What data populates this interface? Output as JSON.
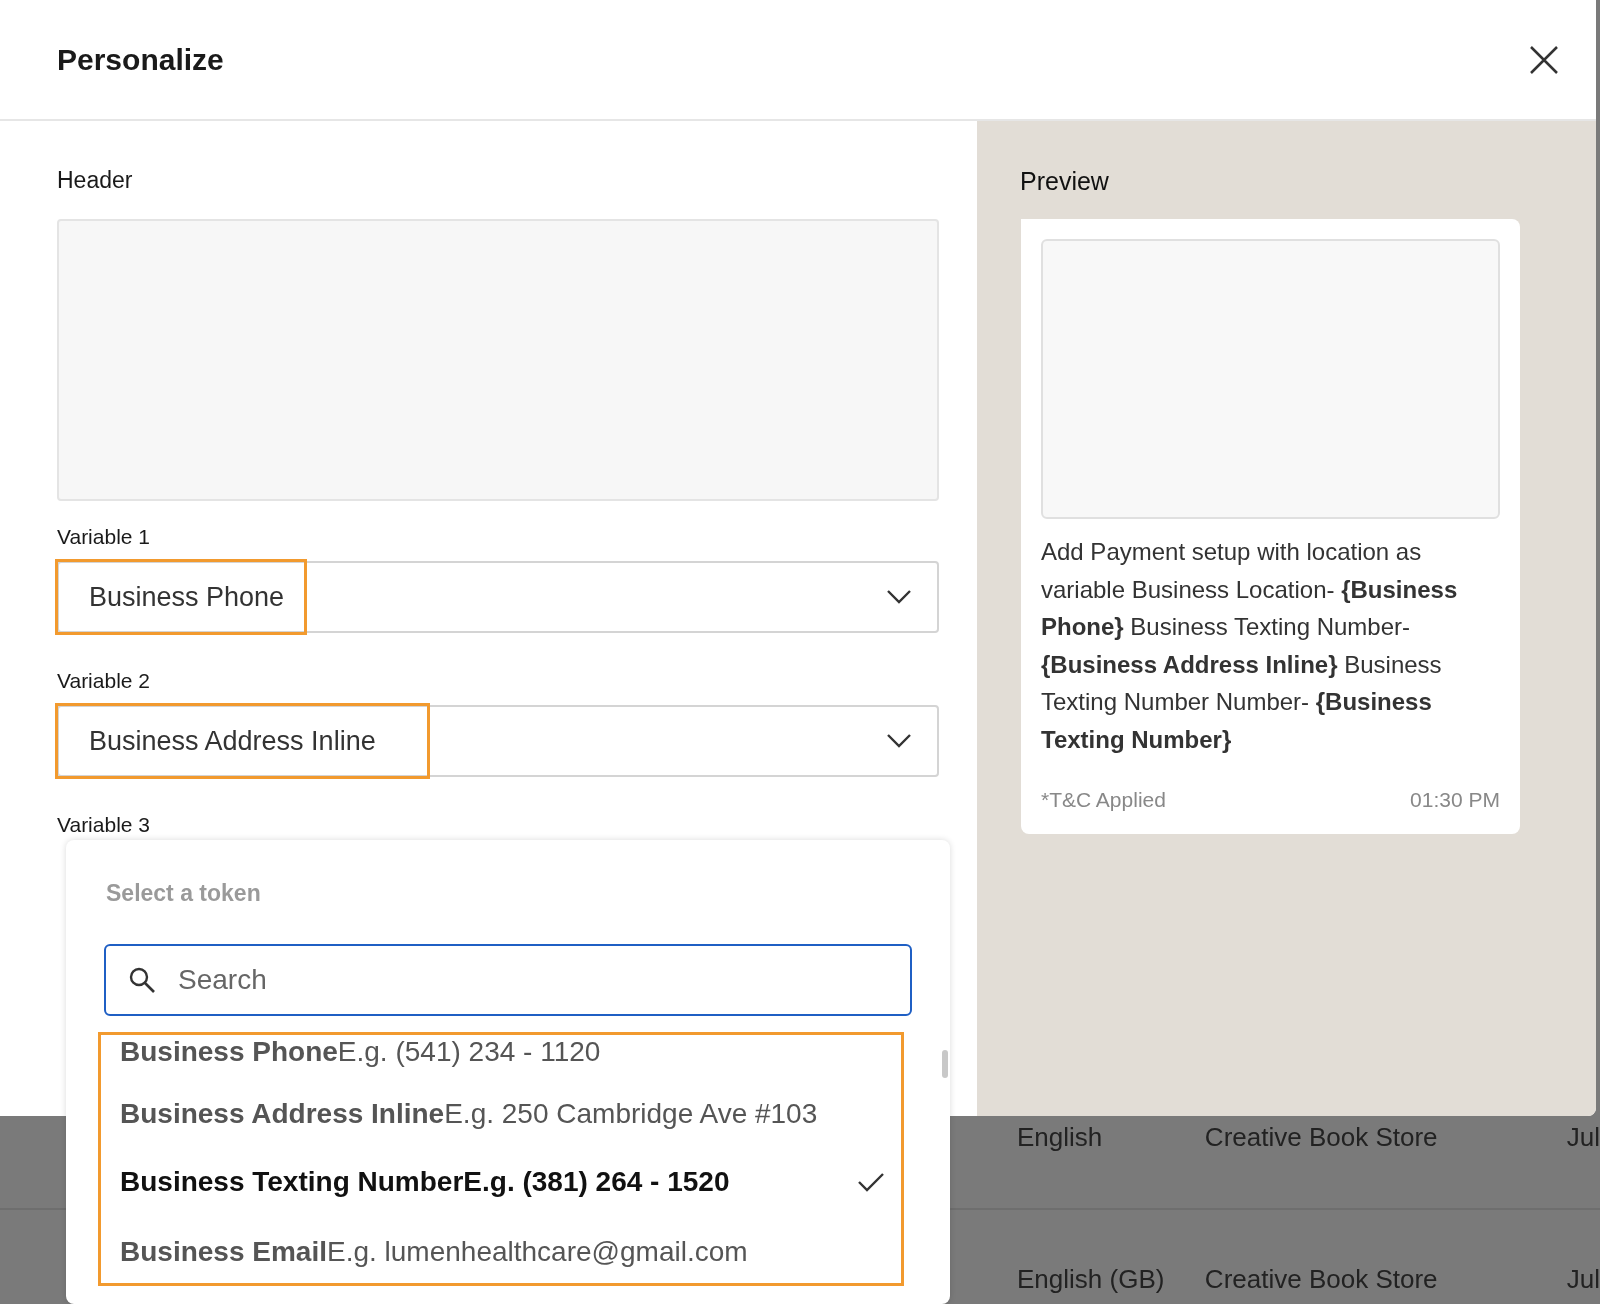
{
  "dialog": {
    "title": "Personalize"
  },
  "header": {
    "label": "Header"
  },
  "variables": [
    {
      "label": "Variable 1",
      "value": "Business Phone",
      "highlighted": true
    },
    {
      "label": "Variable 2",
      "value": "Business Address Inline",
      "highlighted": true
    },
    {
      "label": "Variable 3"
    }
  ],
  "token_menu": {
    "title": "Select a token",
    "search": {
      "placeholder": "Search"
    },
    "highlighted": true,
    "items": [
      {
        "text": "**Business Phone**E.g. (541) 234 - 1120",
        "selected": false
      },
      {
        "text": "**Business Address Inline**E.g. 250 Cambridge Ave #103",
        "selected": false
      },
      {
        "text": "**Business Texting Number**E.g. (381) 264 - 1520",
        "selected": true
      },
      {
        "text": "**Business Email**E.g. lumenhealthcare@gmail.com",
        "selected": false
      }
    ]
  },
  "preview": {
    "label": "Preview",
    "message": "Add Payment setup with location as variable Business Location- **{Business Phone}** Business Texting Number- **{Business Address Inline}** Business Texting Number Number- **{Business Texting Number}**",
    "footer": "*T&C Applied",
    "time": "01:30 PM"
  },
  "background_table": {
    "rows": [
      {
        "cells": [
          "English",
          "Creative Book Store",
          "Jul"
        ]
      },
      {
        "cells": [
          "English (GB)",
          "Creative Book Store",
          "Jul"
        ]
      }
    ]
  }
}
